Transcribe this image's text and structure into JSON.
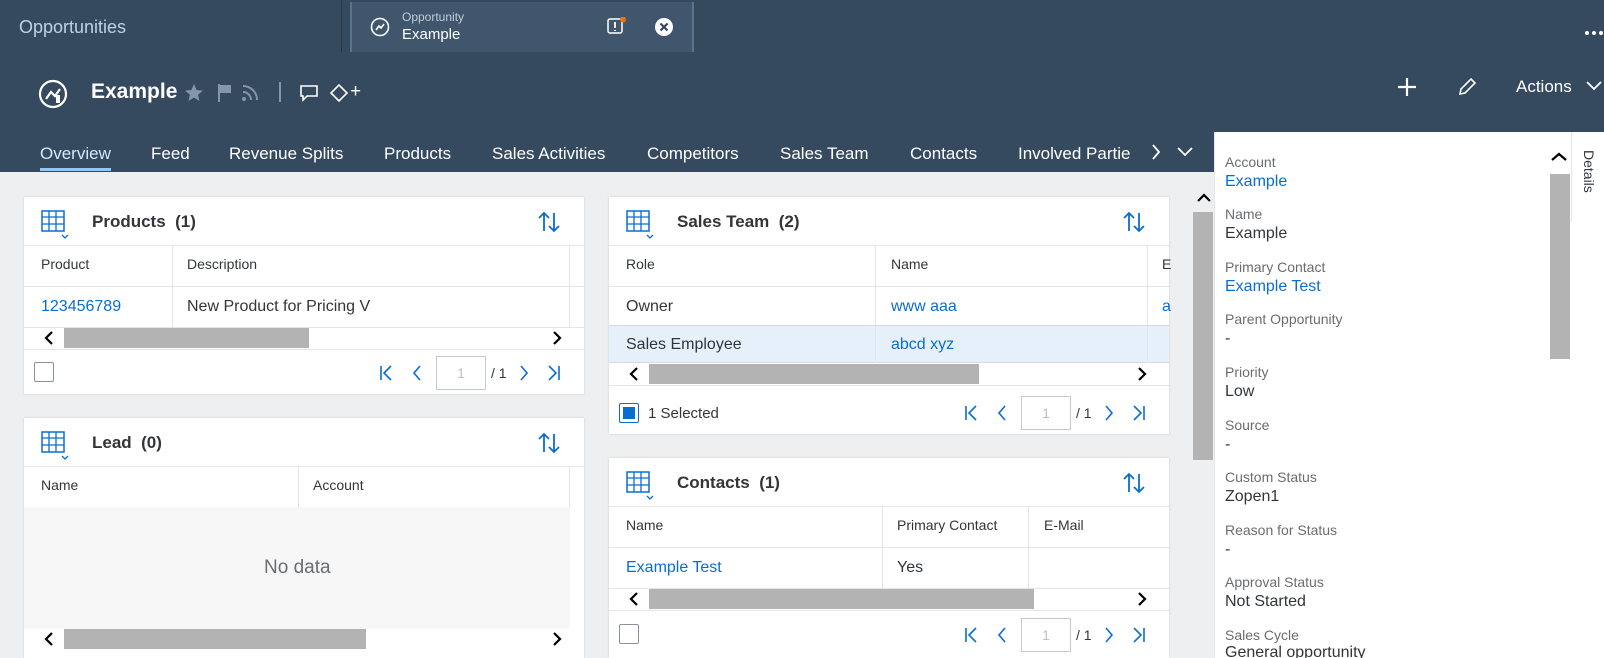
{
  "top_tabs": {
    "tab1_label": "Opportunities",
    "tab2_sub": "Opportunity",
    "tab2_title": "Example"
  },
  "header": {
    "title": "Example",
    "add_label": "+",
    "actions_label": "Actions"
  },
  "nav": [
    "Overview",
    "Feed",
    "Revenue Splits",
    "Products",
    "Sales Activities",
    "Competitors",
    "Sales Team",
    "Contacts",
    "Involved Partie"
  ],
  "products": {
    "title": "Products",
    "count": "(1)",
    "col_product": "Product",
    "col_description": "Description",
    "row_product": "123456789",
    "row_description": "New Product for Pricing V",
    "page_input": "1",
    "page_total": "/ 1"
  },
  "lead": {
    "title": "Lead",
    "count": "(0)",
    "col_name": "Name",
    "col_account": "Account",
    "no_data": "No data"
  },
  "sales_team": {
    "title": "Sales Team",
    "count": "(2)",
    "col_role": "Role",
    "col_name": "Name",
    "col_e": "E",
    "rows": [
      {
        "role": "Owner",
        "name": "www aaa",
        "e": "a"
      },
      {
        "role": "Sales Employee",
        "name": "abcd xyz"
      }
    ],
    "selected_label": "1 Selected",
    "page_input": "1",
    "page_total": "/ 1"
  },
  "contacts": {
    "title": "Contacts",
    "count": "(1)",
    "col_name": "Name",
    "col_primary": "Primary Contact",
    "col_email": "E-Mail",
    "row_name": "Example Test",
    "row_primary": "Yes",
    "page_input": "1",
    "page_total": "/ 1"
  },
  "details": {
    "tab_label": "Details",
    "fields": [
      {
        "label": "Account",
        "value": "Example"
      },
      {
        "label": "Name",
        "value": "Example"
      },
      {
        "label": "Primary Contact",
        "value": "Example Test"
      },
      {
        "label": "Parent Opportunity",
        "value": "-"
      },
      {
        "label": "Priority",
        "value": "Low"
      },
      {
        "label": "Source",
        "value": "-"
      },
      {
        "label": "Custom Status",
        "value": "Zopen1"
      },
      {
        "label": "Reason for Status",
        "value": "-"
      },
      {
        "label": "Approval Status",
        "value": "Not Started"
      },
      {
        "label": "Sales Cycle",
        "value": "General opportunity"
      }
    ]
  },
  "colors": {
    "shell": "#354a5f",
    "link": "#0a6ed1",
    "accent": "#91c8f6"
  },
  "icons": [
    "opportunity-icon",
    "notification-icon",
    "close-icon",
    "overflow-icon",
    "favorite-star-icon",
    "flag-icon",
    "rss-follow-icon",
    "comment-icon",
    "tag-icon",
    "add-icon",
    "edit-icon",
    "chevron-down-icon",
    "table-grid-icon",
    "sort-icon",
    "first-page-icon",
    "prev-page-icon",
    "next-page-icon",
    "last-page-icon",
    "chevron-up-icon"
  ]
}
